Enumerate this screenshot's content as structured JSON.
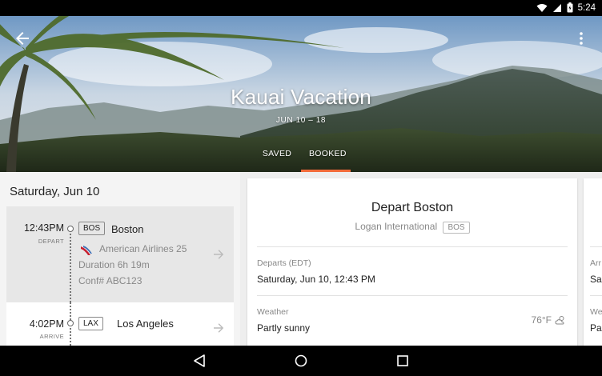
{
  "status_bar": {
    "time": "5:24",
    "icons": [
      "wifi-icon",
      "signal-icon",
      "battery-icon"
    ]
  },
  "hero": {
    "title": "Kauai Vacation",
    "dates": "JUN 10 – 18",
    "tabs": [
      {
        "label": "SAVED",
        "active": false
      },
      {
        "label": "BOOKED",
        "active": true
      }
    ],
    "accent_color": "#f26b3a"
  },
  "itinerary": {
    "day_header": "Saturday, Jun 10",
    "depart": {
      "time": "12:43PM",
      "label": "DEPART",
      "code": "BOS",
      "city": "Boston",
      "airline": "American Airlines 25",
      "duration": "Duration 6h 19m",
      "confirmation": "Conf# ABC123"
    },
    "arrive": {
      "time": "4:02PM",
      "label": "ARRIVE",
      "code": "LAX",
      "city": "Los Angeles"
    }
  },
  "detail_card": {
    "title": "Depart Boston",
    "airport": "Logan International",
    "code": "BOS",
    "departs_label": "Departs (EDT)",
    "departs_value": "Saturday, Jun 10, 12:43 PM",
    "weather_label": "Weather",
    "weather_value": "Partly sunny",
    "temperature": "76°F"
  },
  "peek_card": {
    "label1": "Arr",
    "value1": "Sa",
    "label2": "We",
    "value2": "Pa"
  },
  "nav_bar": {
    "buttons": [
      "back-icon",
      "home-icon",
      "recents-icon"
    ]
  }
}
